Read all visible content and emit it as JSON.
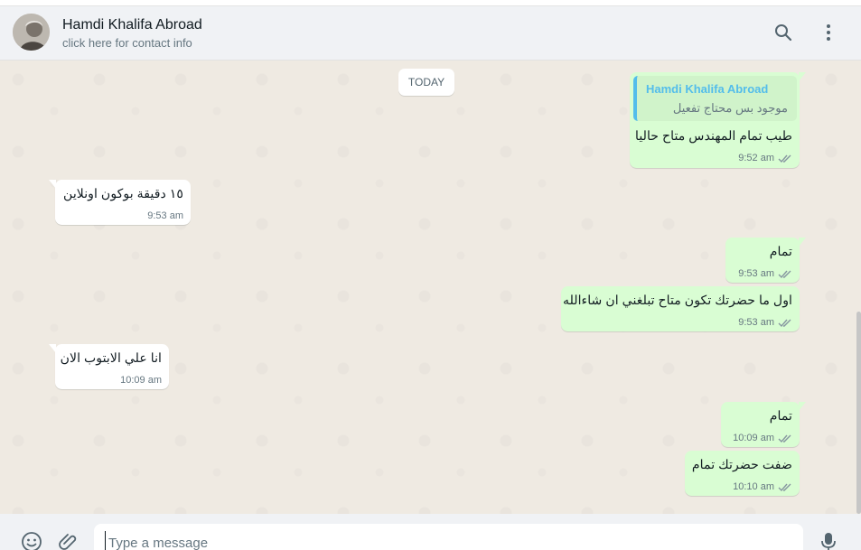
{
  "header": {
    "contact_name": "Hamdi Khalifa Abroad",
    "contact_subtitle": "click here for contact info",
    "avatar_icon": "avatar",
    "search_icon": "search-icon",
    "menu_icon": "menu-dots-icon"
  },
  "chat": {
    "day_label": "TODAY",
    "messages": [
      {
        "direction": "out",
        "quote_author": "Hamdi Khalifa Abroad",
        "quote_text": "موجود  بس محتاج تفعيل",
        "text": "طيب تمام المهندس متاح حاليا",
        "time": "9:52 am",
        "status": "read"
      },
      {
        "direction": "in",
        "text": "١٥ دقيقة  بوكون اونلاين",
        "time": "9:53 am"
      },
      {
        "direction": "out",
        "text": "تمام",
        "time": "9:53 am",
        "status": "read"
      },
      {
        "direction": "out",
        "text": "اول ما حضرتك تكون متاح تبلغني ان شاءالله",
        "time": "9:53 am",
        "status": "read"
      },
      {
        "direction": "in",
        "text": "انا علي الابتوب الان",
        "time": "10:09 am"
      },
      {
        "direction": "out",
        "text": "تمام",
        "time": "10:09 am",
        "status": "read"
      },
      {
        "direction": "out",
        "text": "ضفت حضرتك تمام",
        "time": "10:10 am",
        "status": "read"
      }
    ]
  },
  "composer": {
    "placeholder": "Type a message",
    "value": "",
    "emoji_icon": "emoji-icon",
    "attach_icon": "paperclip-icon",
    "mic_icon": "microphone-icon"
  },
  "colors": {
    "outgoing_bubble": "#d9fdd3",
    "incoming_bubble": "#ffffff",
    "chat_background": "#efeae2",
    "read_tick": "#53bdeb",
    "quote_accent": "#53bdeb"
  }
}
